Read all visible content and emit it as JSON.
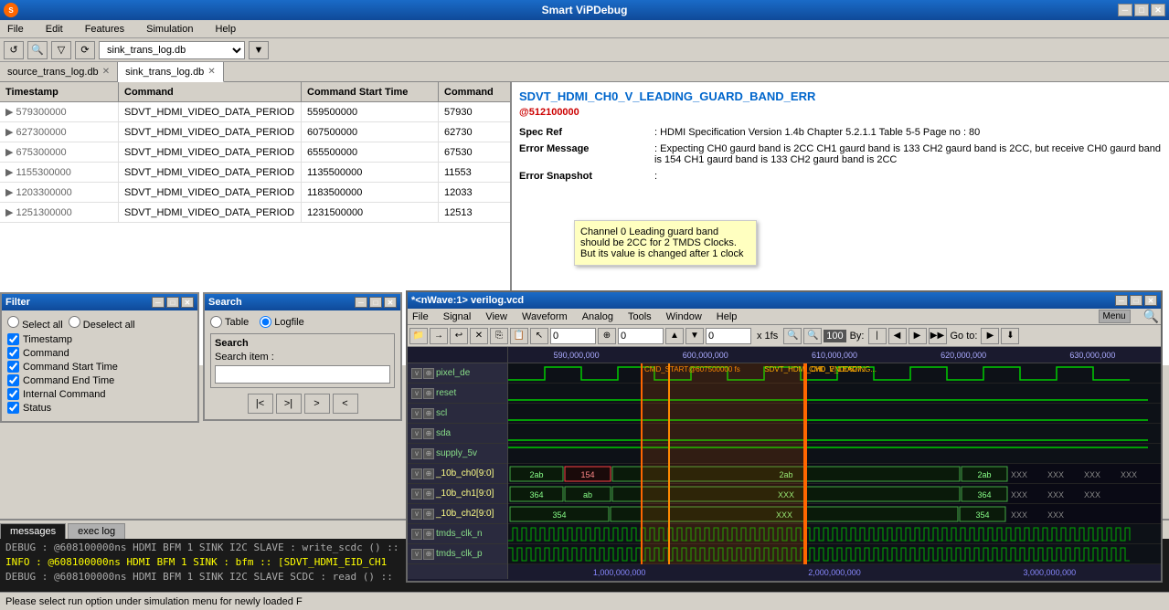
{
  "app": {
    "title": "Smart ViPDebug",
    "icon": "S"
  },
  "menubar": {
    "items": [
      "File",
      "Edit",
      "Features",
      "Simulation",
      "Help"
    ]
  },
  "toolbar": {
    "db_dropdown_value": "sink_trans_log.db"
  },
  "tabs": [
    {
      "label": "source_trans_log.db",
      "active": false
    },
    {
      "label": "sink_trans_log.db",
      "active": true
    }
  ],
  "table": {
    "headers": [
      "Timestamp",
      "Command",
      "Command Start Time",
      "Command"
    ],
    "rows": [
      {
        "expand": "▶",
        "timestamp": "579300000",
        "command": "SDVT_HDMI_VIDEO_DATA_PERIOD",
        "start_time": "559500000",
        "cmd_end": "57930"
      },
      {
        "expand": "▶",
        "timestamp": "627300000",
        "command": "SDVT_HDMI_VIDEO_DATA_PERIOD",
        "start_time": "607500000",
        "cmd_end": "62730"
      },
      {
        "expand": "▶",
        "timestamp": "675300000",
        "command": "SDVT_HDMI_VIDEO_DATA_PERIOD",
        "start_time": "655500000",
        "cmd_end": "67530"
      },
      {
        "expand": "▶",
        "timestamp": "1155300000",
        "command": "SDVT_HDMI_VIDEO_DATA_PERIOD",
        "start_time": "1135500000",
        "cmd_end": "11553"
      },
      {
        "expand": "▶",
        "timestamp": "1203300000",
        "command": "SDVT_HDMI_VIDEO_DATA_PERIOD",
        "start_time": "1183500000",
        "cmd_end": "12033"
      },
      {
        "expand": "▶",
        "timestamp": "1251300000",
        "command": "SDVT_HDMI_VIDEO_DATA_PERIOD",
        "start_time": "1231500000",
        "cmd_end": "12513"
      }
    ]
  },
  "error_info": {
    "title": "SDVT_HDMI_CH0_V_LEADING_GUARD_BAND_ERR",
    "timestamp": "@512100000",
    "spec_ref_label": "Spec Ref",
    "spec_ref_value": ": HDMI Specification Version 1.4b Chapter 5.2.1.1 Table 5-5 Page no : 80",
    "error_msg_label": "Error Message",
    "error_msg_value": ": Expecting CH0 gaurd band is 2CC CH1 gaurd band is 133 CH2 gaurd band is 2CC,  but receive CH0 gaurd band is 154 CH1 gaurd band is 133 CH2 gaurd band is 2CC",
    "error_snap_label": "Error Snapshot",
    "tooltip": "Channel 0 Leading guard band should be 2CC for 2 TMDS Clocks. But its value is changed after 1 clock"
  },
  "filter_panel": {
    "title": "Filter",
    "select_all": "Select all",
    "deselect_all": "Deselect all",
    "items": [
      {
        "label": "Timestamp",
        "checked": true
      },
      {
        "label": "Command",
        "checked": true
      },
      {
        "label": "Command Start Time",
        "checked": true
      },
      {
        "label": "Command End Time",
        "checked": true
      },
      {
        "label": "Internal Command",
        "checked": true
      },
      {
        "label": "Status",
        "checked": true
      }
    ]
  },
  "search_panel": {
    "title": "Search",
    "radio_table": "Table",
    "radio_logfile": "Logfile",
    "radio_logfile_checked": true,
    "search_label": "Search",
    "search_item_label": "Search item :",
    "search_placeholder": "",
    "nav_buttons": [
      "|<",
      ">|",
      ">",
      "<"
    ]
  },
  "wave_panel": {
    "title": "*<nWave:1> verilog.vcd",
    "menus": [
      "File",
      "Signal",
      "View",
      "Waveform",
      "Analog",
      "Tools",
      "Window",
      "Help"
    ],
    "menu_btn": "Menu",
    "cursor_value": "0",
    "cursor2_value": "0",
    "step_value": "0",
    "zoom_label": "x 1fs",
    "by_label": "By:",
    "goto_label": "Go to:",
    "timeline_labels": [
      "590,000,000",
      "600,000,000",
      "610,000,000",
      "620,000,000",
      "630,000,000"
    ],
    "signals": [
      {
        "name": "pixel_de",
        "type": "var"
      },
      {
        "name": "reset",
        "type": "var"
      },
      {
        "name": "scl",
        "type": "var"
      },
      {
        "name": "sda",
        "type": "var"
      },
      {
        "name": "supply_5v",
        "type": "var"
      },
      {
        "name": "_10b_ch0[9:0]",
        "type": "var"
      },
      {
        "name": "_10b_ch1[9:0]",
        "type": "var"
      },
      {
        "name": "_10b_ch2[9:0]",
        "type": "var"
      },
      {
        "name": "tmds_clk_n",
        "type": "var"
      },
      {
        "name": "tmds_clk_p",
        "type": "var"
      }
    ],
    "bottom_labels": [
      "1,000,000,000",
      "2,000,000,000",
      "3,000,000,000"
    ],
    "cmd_label": "CMD_START@607500000 fs",
    "cmd_label2": "SDVT_HDMI_CH0_V_LEADING_GUARD_BAND_ERR 950...",
    "cmd_end_label": "CMD_END0627..."
  },
  "console": {
    "tabs": [
      "messages",
      "exec log"
    ],
    "active_tab": "messages",
    "lines": [
      {
        "type": "debug",
        "text": "DEBUG : @608100000ns HDMI BFM 1 SINK I2C SLAVE : write_scdc () ::"
      },
      {
        "type": "info",
        "text": "INFO  : @608100000ns HDMI BFM 1 SINK : bfm :: [SDVT_HDMI_EID_CH1"
      },
      {
        "type": "debug",
        "text": "DEBUG : @608100000ns HDMI BFM 1 SINK I2C SLAVE SCDC : read () ::"
      }
    ],
    "status": "Please select run option under simulation menu for newly loaded F"
  }
}
